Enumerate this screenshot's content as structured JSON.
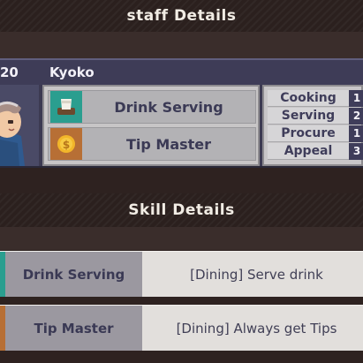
{
  "staff_section": {
    "title": "staff Details"
  },
  "staff": {
    "level": "20",
    "name": "Kyoko",
    "skills": [
      {
        "label": "Drink Serving",
        "icon": "drink-cup-icon"
      },
      {
        "label": "Tip Master",
        "icon": "coin-icon"
      }
    ],
    "stats": [
      {
        "label": "Cooking",
        "value": "1"
      },
      {
        "label": "Serving",
        "value": "2"
      },
      {
        "label": "Procure",
        "value": "1"
      },
      {
        "label": "Appeal",
        "value": "3"
      }
    ]
  },
  "skill_section": {
    "title": "Skill Details"
  },
  "skill_details": [
    {
      "name": "Drink Serving",
      "description": "[Dining] Serve drink"
    },
    {
      "name": "Tip Master",
      "description": "[Dining] Always get Tips"
    }
  ],
  "colors": {
    "drink_accent": "#2a9e8f",
    "tip_accent": "#b76f35",
    "card_header": "#3e3c57"
  }
}
